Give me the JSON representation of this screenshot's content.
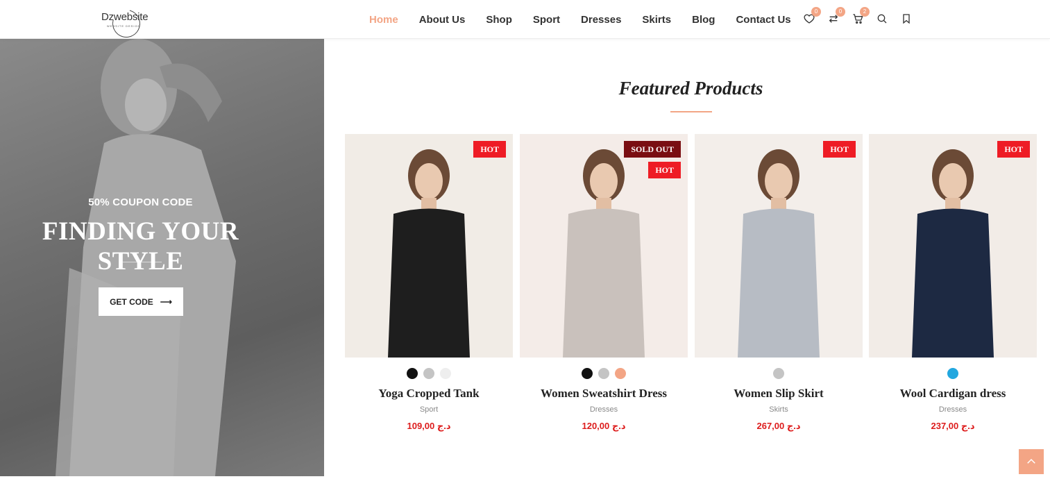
{
  "header": {
    "logo_text": "Dzwebsite",
    "logo_sub": "WEBSITE DESIGN",
    "nav": [
      "Home",
      "About Us",
      "Shop",
      "Sport",
      "Dresses",
      "Skirts",
      "Blog",
      "Contact Us"
    ],
    "wishlist_count": "0",
    "compare_count": "0",
    "cart_count": "2"
  },
  "banner": {
    "subtitle": "50% COUPON CODE",
    "title": "FINDING YOUR STYLE",
    "button": "GET CODE"
  },
  "featured": {
    "title": "Featured Products",
    "products": [
      {
        "name": "Yoga Cropped Tank",
        "category": "Sport",
        "price": "109,00 د.ج",
        "tags": [
          "HOT"
        ],
        "swatches": [
          "#111111",
          "#c4c4c4",
          "#eeeeee"
        ],
        "bg": "#f1ece6"
      },
      {
        "name": "Women Sweatshirt Dress",
        "category": "Dresses",
        "price": "120,00 د.ج",
        "tags": [
          "SOLD OUT",
          "HOT"
        ],
        "swatches": [
          "#111111",
          "#c4c4c4",
          "#f3a585"
        ],
        "bg": "#f4ece8"
      },
      {
        "name": "Women Slip Skirt",
        "category": "Skirts",
        "price": "267,00 د.ج",
        "tags": [
          "HOT"
        ],
        "swatches": [
          "#c4c4c4"
        ],
        "bg": "#f3eeea"
      },
      {
        "name": "Wool Cardigan dress",
        "category": "Dresses",
        "price": "237,00 د.ج",
        "tags": [
          "HOT"
        ],
        "swatches": [
          "#22a7df"
        ],
        "bg": "#f2ece7"
      }
    ]
  },
  "colors": {
    "accent": "#f3a585",
    "hot": "#ee1c25",
    "sold": "#7a0e12",
    "price": "#dd1c1c"
  }
}
